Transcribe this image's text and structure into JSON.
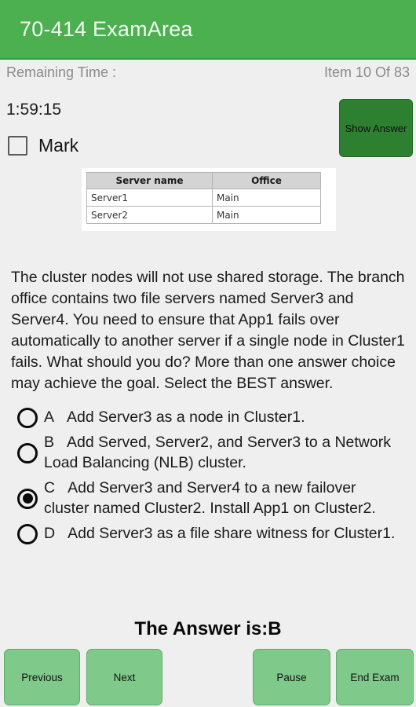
{
  "header": {
    "title": "70-414 ExamArea",
    "bg_color": "#4caf50"
  },
  "status": {
    "remaining_time_label": "Remaining Time :",
    "item_counter": "Item 10 Of 83",
    "timer_value": "1:59:15"
  },
  "controls": {
    "show_answer_label": "Show Answer",
    "show_answer_color": "#2e8031",
    "mark_label": "Mark",
    "mark_checked": false
  },
  "exhibit": {
    "columns": [
      "Server name",
      "Office"
    ],
    "rows": [
      [
        "Server1",
        "Main"
      ],
      [
        "Server2",
        "Main"
      ]
    ]
  },
  "question": {
    "text": "The cluster nodes will not use shared storage. The branch office contains two file servers named Server3 and Server4. You need to ensure that App1 fails over automatically to another server if a single node in Cluster1 fails. What should you do? More than one answer choice may achieve the goal. Select the BEST answer."
  },
  "options": [
    {
      "letter": "A",
      "text": "Add Server3 as a node in Cluster1.",
      "selected": false
    },
    {
      "letter": "B",
      "text": "Add Served, Server2, and Server3 to a Network Load Balancing (NLB) cluster.",
      "selected": false
    },
    {
      "letter": "C",
      "text": "Add Server3 and Server4 to a new failover cluster named Cluster2. Install App1 on Cluster2.",
      "selected": true
    },
    {
      "letter": "D",
      "text": "Add Server3 as a file share witness for Cluster1.",
      "selected": false
    }
  ],
  "answer_reveal": {
    "text": "The Answer is:B"
  },
  "navigation": {
    "previous_label": "Previous",
    "next_label": "Next",
    "pause_label": "Pause",
    "end_exam_label": "End Exam",
    "button_color": "#7fc98a"
  }
}
